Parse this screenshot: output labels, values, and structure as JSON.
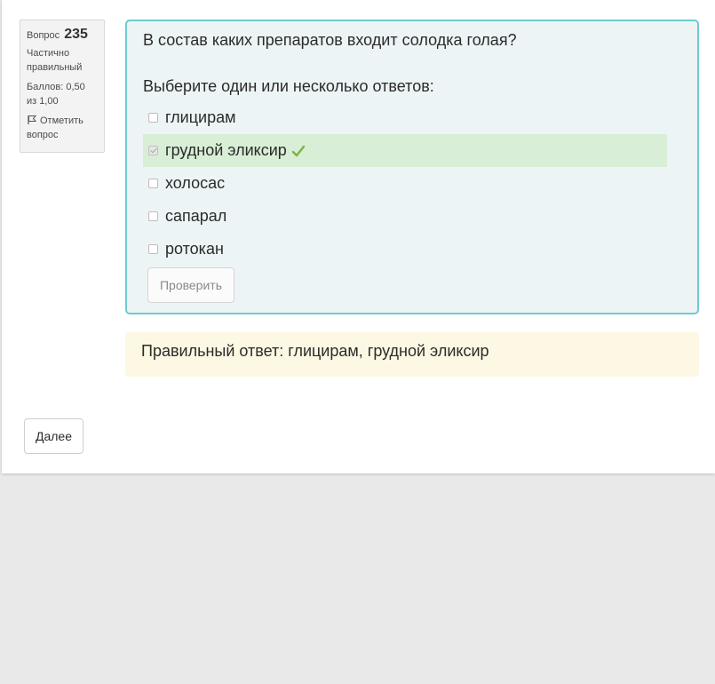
{
  "info": {
    "question_label": "Вопрос",
    "question_number": "235",
    "state": "Частично правильный",
    "grade": "Баллов: 0,50 из 1,00",
    "flag_label": "Отметить вопрос",
    "flag_icon": "flag-icon"
  },
  "question": {
    "text": "В состав каких препаратов входит солодка голая?",
    "prompt": "Выберите один или несколько ответов:",
    "answers": [
      {
        "label": "глицирам",
        "checked": false,
        "correct_mark": false
      },
      {
        "label": "грудной эликсир",
        "checked": true,
        "correct_mark": true
      },
      {
        "label": "холосас",
        "checked": false,
        "correct_mark": false
      },
      {
        "label": "сапарал",
        "checked": false,
        "correct_mark": false
      },
      {
        "label": "ротокан",
        "checked": false,
        "correct_mark": false
      }
    ],
    "check_button": "Проверить"
  },
  "feedback": {
    "right_answer": "Правильный ответ: глицирам, грудной эликсир"
  },
  "nav": {
    "next_button": "Далее"
  },
  "colors": {
    "question_border": "#6ecbd0",
    "question_bg": "#edf4f6",
    "correct_bg": "#d8eed6",
    "right_answer_bg": "#fcf8e3",
    "tick": "#7cb342"
  }
}
